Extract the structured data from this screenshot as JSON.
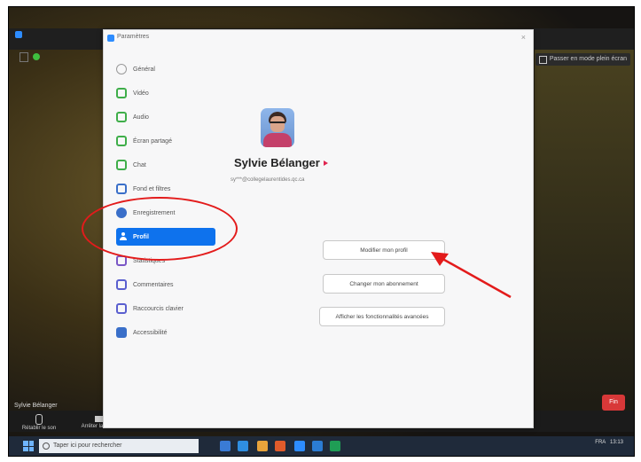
{
  "settings_window": {
    "title": "Paramètres",
    "close_glyph": "×"
  },
  "sidebar": {
    "items": [
      {
        "label": "Général",
        "icon": "gear-icon",
        "color": "#9a9a9a"
      },
      {
        "label": "Vidéo",
        "icon": "video-icon",
        "color": "#3fae4a"
      },
      {
        "label": "Audio",
        "icon": "headphones-icon",
        "color": "#3fae4a"
      },
      {
        "label": "Écran partagé",
        "icon": "share-screen-icon",
        "color": "#3fae4a"
      },
      {
        "label": "Chat",
        "icon": "chat-icon",
        "color": "#3fae4a"
      },
      {
        "label": "Fond et filtres",
        "icon": "background-icon",
        "color": "#3a6fc9"
      },
      {
        "label": "Enregistrement",
        "icon": "record-icon",
        "color": "#3a6fc9"
      },
      {
        "label": "Profil",
        "icon": "profile-icon",
        "color": "#ffffff"
      },
      {
        "label": "Statistiques",
        "icon": "statistics-icon",
        "color": "#7a57c6"
      },
      {
        "label": "Commentaires",
        "icon": "feedback-icon",
        "color": "#5a5fcf"
      },
      {
        "label": "Raccourcis clavier",
        "icon": "keyboard-icon",
        "color": "#5a5fcf"
      },
      {
        "label": "Accessibilité",
        "icon": "accessibility-icon",
        "color": "#3a6fc9"
      }
    ],
    "active_index": 7
  },
  "profile": {
    "name": "Sylvie Bélanger",
    "email": "sy***@collegelaurentides.qc.ca",
    "buttons": {
      "edit_profile": "Modifier mon profil",
      "change_subscription": "Changer mon abonnement",
      "view_features": "Afficher les fonctionnalités avancées"
    }
  },
  "meeting": {
    "speaker_name": "Sylvie Bélanger",
    "fullscreen_label": "Passer en mode plein écran",
    "controls": {
      "mute": "Rétablir le son",
      "video": "Arrêter la vidéo"
    },
    "end_label": "Fin"
  },
  "taskbar": {
    "search_placeholder": "Taper ici pour rechercher",
    "language": "FRA",
    "time": "13:13"
  },
  "annotations": {
    "highlight_color": "#e31b1b"
  }
}
